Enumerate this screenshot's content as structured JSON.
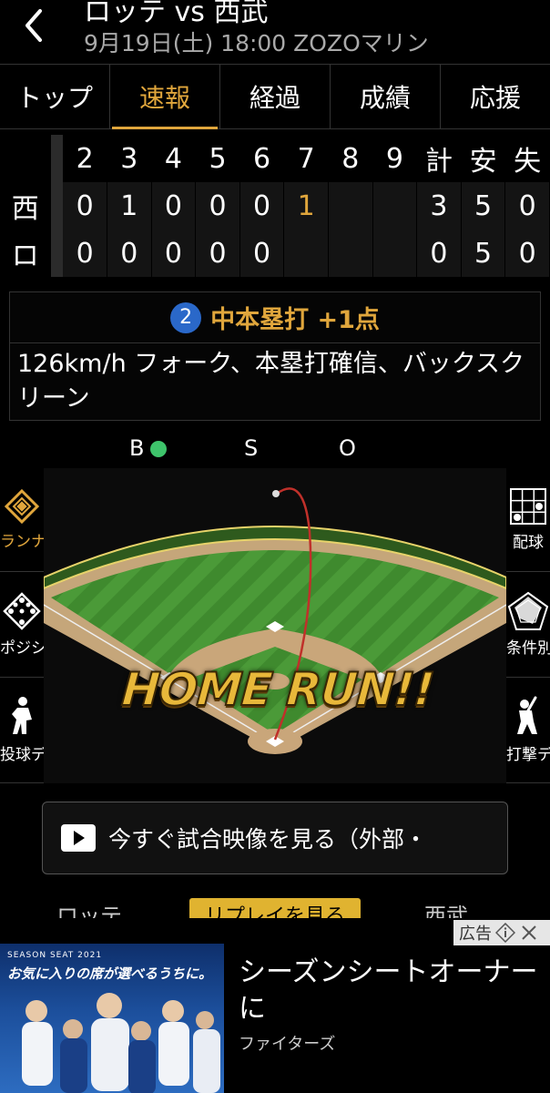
{
  "header": {
    "title": "ロッテ vs 西武",
    "subtitle": "9月19日(土) 18:00 ZOZOマリン"
  },
  "tabs": [
    {
      "label": "トップ",
      "active": false
    },
    {
      "label": "速報",
      "active": true
    },
    {
      "label": "経過",
      "active": false
    },
    {
      "label": "成績",
      "active": false
    },
    {
      "label": "応援",
      "active": false
    }
  ],
  "scoreboard": {
    "headers": [
      "2",
      "3",
      "4",
      "5",
      "6",
      "7",
      "8",
      "9",
      "計",
      "安",
      "失"
    ],
    "rows": [
      {
        "team": "西",
        "cells": [
          "0",
          "1",
          "0",
          "0",
          "0",
          "1",
          "",
          "",
          "3",
          "5",
          "0"
        ]
      },
      {
        "team": "ロ",
        "cells": [
          "0",
          "0",
          "0",
          "0",
          "0",
          "",
          "",
          "",
          "0",
          "5",
          "0"
        ]
      }
    ]
  },
  "play": {
    "number": "2",
    "title": "中本塁打 +1点",
    "description": "126km/h フォーク、本塁打確信、バックスクリーン"
  },
  "bso": {
    "b": "B",
    "s": "S",
    "o": "O"
  },
  "side_left": [
    {
      "label": "ランナー",
      "icon": "diamond-runner-icon",
      "active": true
    },
    {
      "label": "ポジション",
      "icon": "position-icon",
      "active": false
    },
    {
      "label": "投球データ",
      "icon": "pitcher-icon",
      "active": false
    }
  ],
  "side_right": [
    {
      "label": "配球",
      "icon": "pitch-grid-icon"
    },
    {
      "label": "条件別成績",
      "icon": "radar-chart-icon"
    },
    {
      "label": "打撃データ",
      "icon": "batter-icon"
    }
  ],
  "field": {
    "overlay_text": "HOME RUN!!"
  },
  "video": {
    "label": "今すぐ試合映像を見る（外部・"
  },
  "strip": {
    "left": "ロッテ",
    "button": "リプレイを見る",
    "right": "西武"
  },
  "ad": {
    "tag": "広告",
    "title": "シーズンシートオーナーに",
    "sponsor": "ファイターズ",
    "image_caption": "SEASON SEAT 2021",
    "image_headline": "お気に入りの席が選べるうちに。"
  },
  "colors": {
    "accent": "#e0a63c",
    "badge": "#2a68c9",
    "ball": "#3ec46b"
  }
}
